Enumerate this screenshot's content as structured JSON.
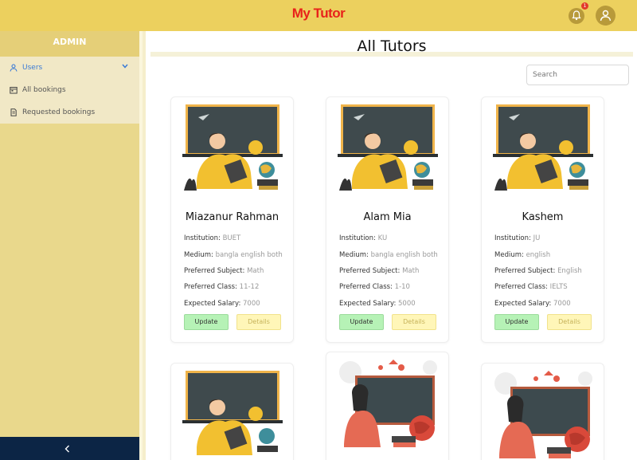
{
  "header": {
    "brand": "My Tutor",
    "notification_count": "1"
  },
  "sidebar": {
    "title": "ADMIN",
    "items": [
      {
        "label": "Users",
        "icon": "user-icon",
        "expanded": true
      },
      {
        "label": "All bookings",
        "icon": "calendar-icon"
      },
      {
        "label": "Requested bookings",
        "icon": "document-icon"
      }
    ]
  },
  "main": {
    "title": "All Tutors",
    "search_placeholder": "Search",
    "labels": {
      "institution": "Institution:",
      "medium": "Medium:",
      "subject": "Preferred Subject:",
      "class": "Preferred Class:",
      "salary": "Expected Salary:",
      "update": "Update",
      "details": "Details"
    },
    "tutors": [
      {
        "name": "Miazanur Rahman",
        "institution": "BUET",
        "medium": "bangla english both",
        "subject": "Math",
        "class": "11-12",
        "salary": "7000"
      },
      {
        "name": "Alam Mia",
        "institution": "KU",
        "medium": "bangla english both",
        "subject": "Math",
        "class": "1-10",
        "salary": "5000"
      },
      {
        "name": "Kashem",
        "institution": "JU",
        "medium": "english",
        "subject": "English",
        "class": "IELTS",
        "salary": "7000"
      }
    ]
  },
  "colors": {
    "header": "#ecd05e",
    "brand": "#e8221b",
    "sidebar": "#e9d88c",
    "collapse_bar": "#0c2545",
    "update": "#b6f2b6",
    "details": "#fff6b8"
  }
}
